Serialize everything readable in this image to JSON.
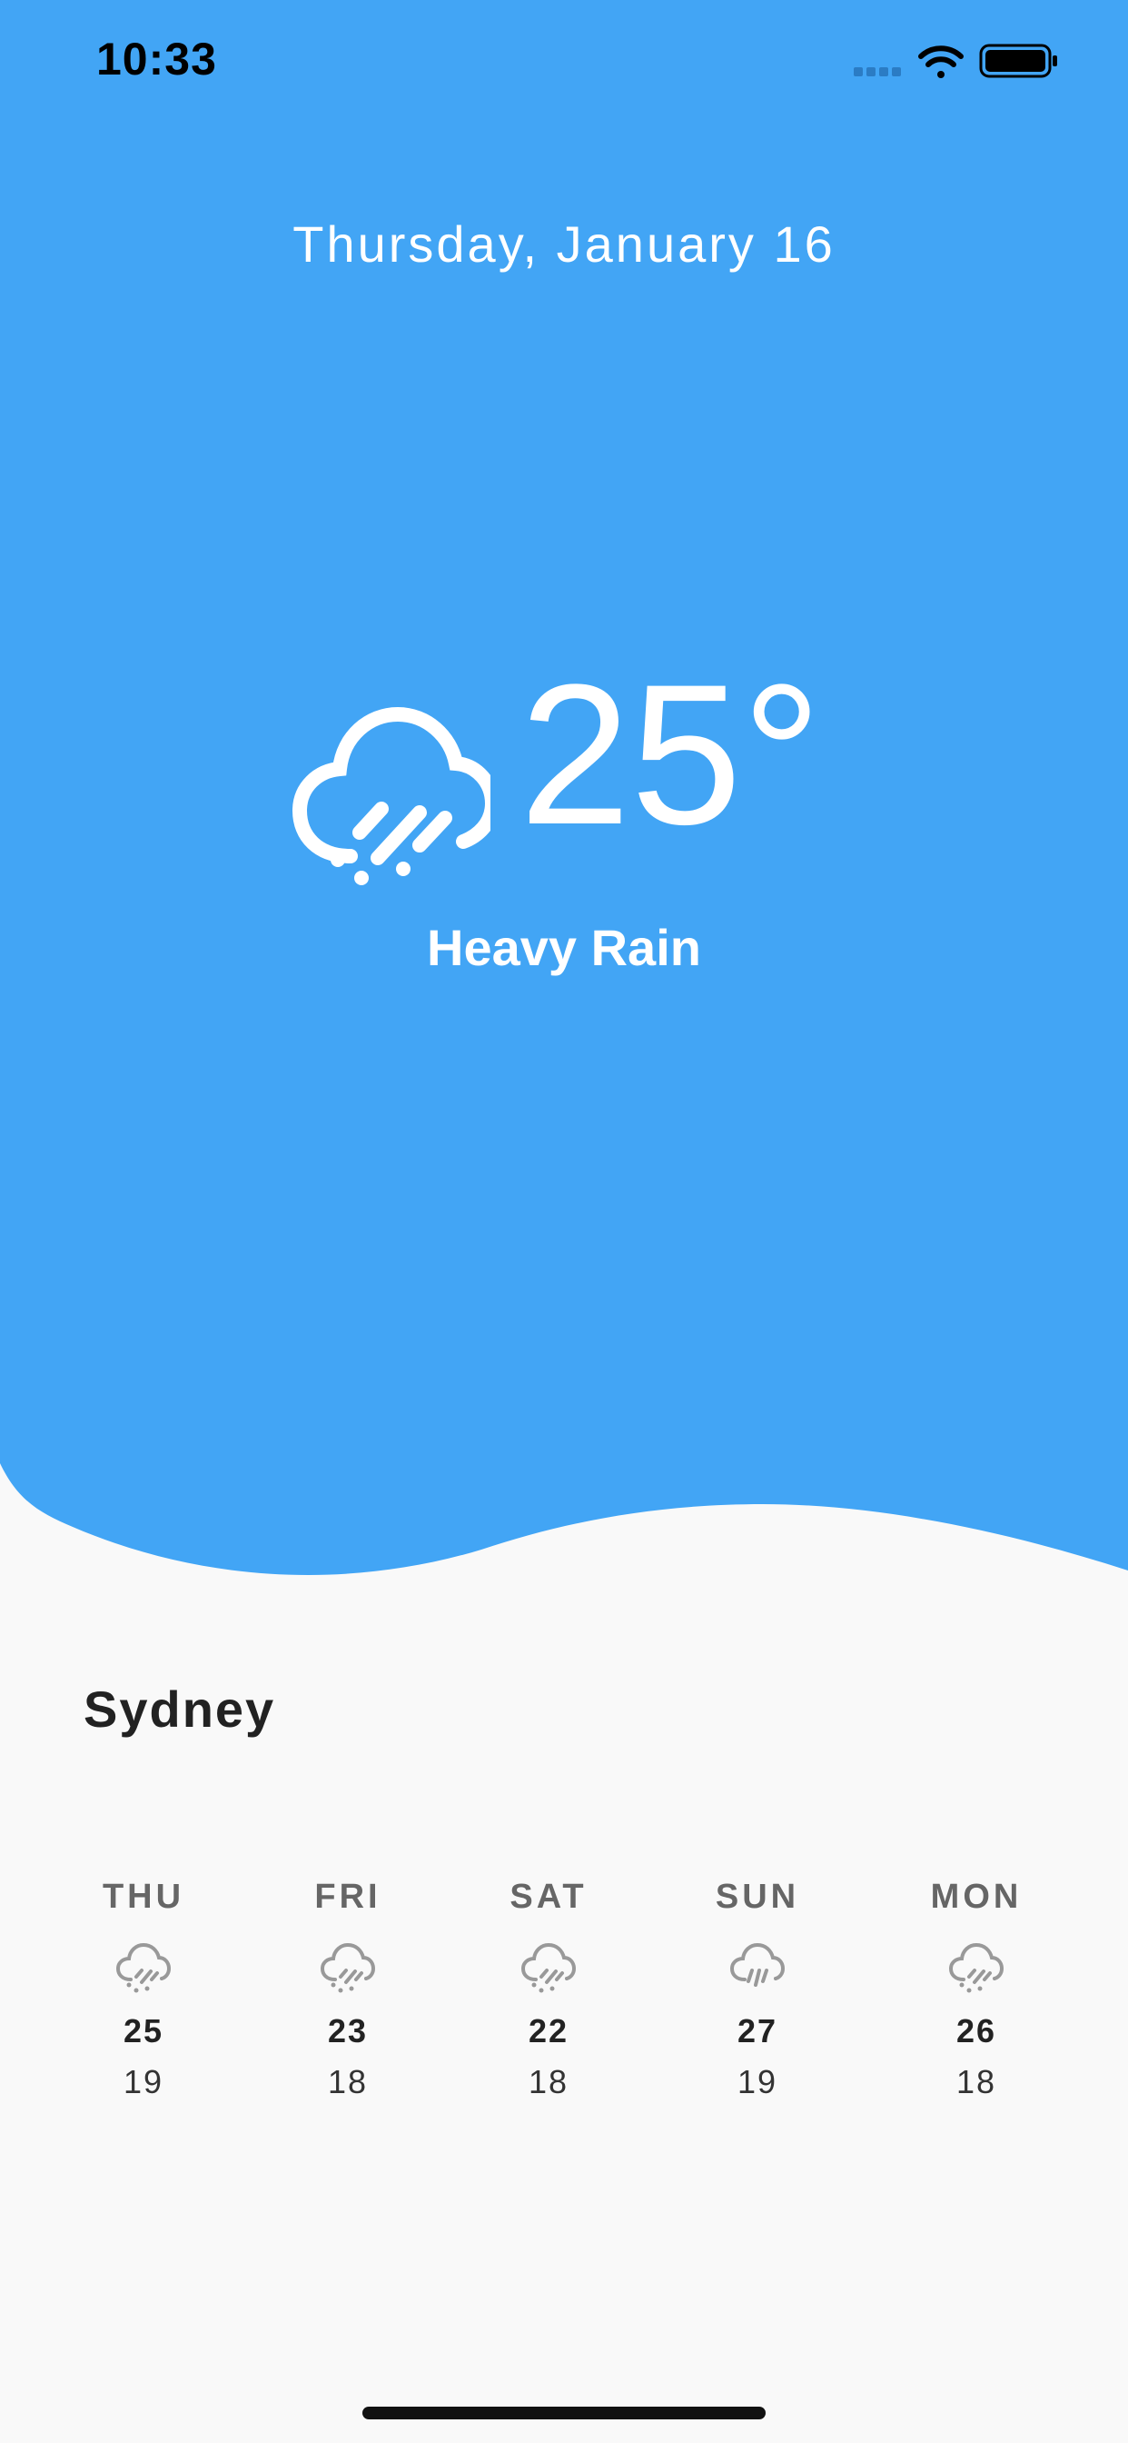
{
  "colors": {
    "hero": "#42A5F5",
    "background": "#F9F9F9",
    "text_dark": "#222222",
    "text_muted": "#666666"
  },
  "status_bar": {
    "time": "10:33",
    "icons": [
      "signal-icon",
      "wifi-icon",
      "battery-icon"
    ]
  },
  "current": {
    "date": "Thursday, January 16",
    "temperature": "25°",
    "condition": "Heavy Rain",
    "icon": "heavy-rain-icon"
  },
  "city": "Sydney",
  "forecast": [
    {
      "day": "THU",
      "high": "25",
      "low": "19",
      "icon": "rain-cloud-icon"
    },
    {
      "day": "FRI",
      "high": "23",
      "low": "18",
      "icon": "rain-cloud-icon"
    },
    {
      "day": "SAT",
      "high": "22",
      "low": "18",
      "icon": "rain-cloud-icon"
    },
    {
      "day": "SUN",
      "high": "27",
      "low": "19",
      "icon": "rain-cloud-icon"
    },
    {
      "day": "MON",
      "high": "26",
      "low": "18",
      "icon": "rain-cloud-icon"
    }
  ]
}
